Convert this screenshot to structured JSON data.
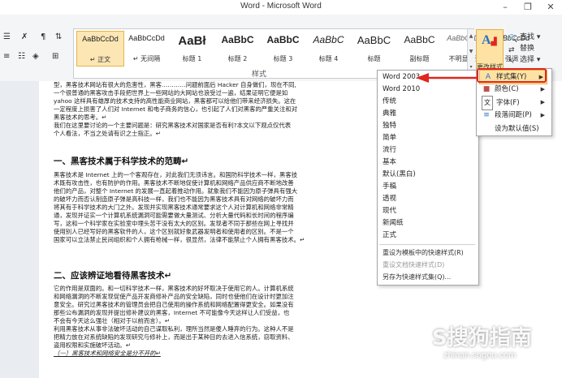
{
  "window": {
    "title": "Word - Microsoft Word",
    "min_symbol": "–",
    "restore_symbol": "❐",
    "close_symbol": "✕"
  },
  "ribbon": {
    "styles_group_label": "样式",
    "styles": [
      {
        "preview": "AaBbCcDd",
        "name": "↵ 正文",
        "selected": true
      },
      {
        "preview": "AaBbCcDd",
        "name": "↵ 无间隔",
        "selected": false
      },
      {
        "preview": "AaBł",
        "name": "标题 1",
        "selected": false
      },
      {
        "preview": "AaBbC",
        "name": "标题 2",
        "selected": false
      },
      {
        "preview": "AaBbC",
        "name": "标题 3",
        "selected": false
      },
      {
        "preview": "AaBbC",
        "name": "标题 4",
        "selected": false
      },
      {
        "preview": "AaBbC",
        "name": "标题",
        "selected": false
      },
      {
        "preview": "AaBbC",
        "name": "副标题",
        "selected": false
      },
      {
        "preview": "AaBbCcDd",
        "name": "不明显强调",
        "selected": false
      },
      {
        "preview": "AaBbCcDd",
        "name": "强调",
        "selected": false
      }
    ],
    "change_styles_label": "更改样式",
    "editing": {
      "find": "查找",
      "replace": "替换",
      "select": "选择"
    }
  },
  "change_styles_menu": {
    "items": [
      {
        "icon": "A",
        "label": "样式集(Y)",
        "has_arrow": true
      },
      {
        "icon": "■",
        "label": "颜色(C)",
        "has_arrow": true
      },
      {
        "icon": "文",
        "label": "字体(F)",
        "has_arrow": true
      },
      {
        "icon": "≡",
        "label": "段落间距(P)",
        "has_arrow": true
      },
      {
        "icon": "",
        "label": "设为默认值(S)",
        "has_arrow": false
      }
    ]
  },
  "style_set_menu": {
    "options": [
      "Word 2003",
      "Word 2010",
      "传统",
      "典雅",
      "独特",
      "简单",
      "流行",
      "基本",
      "默认(黑白)",
      "手稿",
      "透视",
      "现代",
      "新闻纸",
      "正式"
    ],
    "actions": [
      "重设为模板中的快速样式(R)",
      "重设文档快速样式(D)",
      "另存为快速样式集(Q)..."
    ]
  },
  "document": {
    "para_top": [
      "型，黑客技术网站有很大的危害性，黑客…………问题前面后 Hacker 自身做们，现在不同,",
      "一个很普通的黑客攻击手段把世界上一些网站的大网站也浪受过一遍，结果证明它便是如",
      "yahoo 这样具有雄厚的技术支持的高性能商业网站，黑客都可以给他们带来经济损失。这在",
      "一定程度上损害了人们对 Internet 和电子商务的信心，也引起了人们对黑客的严重关注和对",
      "黑客技术的思考。↵",
      "我们在这里要讨论的一个主要问题是：研究黑客技术对国家是否有利?本文以下观点仅代表",
      "个人看法，不当之处请有识之士指正。↵"
    ],
    "heading1": "一、黑客技术属于科学技术的范畴↵",
    "para_mid": [
      "黑客技术是 Internet 上的一个客观存在，对此我们无须讳言。和国防科学技术一样，黑客技",
      "术既有攻击性，也有防护的作用。黑客技术不断地促使计算机和网络产品供应商不断地改善",
      "他们的产品，对整个 Internet 的发展一直起着推动作用。就象我们不能因为原子弹具有强大",
      "的破坏力而否认制造原子弹是高科技一样，我们也不能因为黑客技术具有对网络的破坏力而",
      "将其有于科学技术的大门之外。发现并实现黑客技术通常要求这个人对计算机和网络非常精",
      "通，发现并证实一个计算机系统漏洞可能需要做大量测试、分析大量代码和长时间的程序编",
      "写，这和一个科学家在实验室中埋头苦干没有太大的区别。发现者不同于那些在网上寻找并",
      "使用别人已经写好的黑客软件的人，这个区别就好象武器发明者和使用者的区别。不是一个",
      "国家可以立法禁止民间组织和个人拥有枪械一样，很显然，法律不能禁止个人拥有黑客技术。↵"
    ],
    "heading2": "二、应该辨证地看待黑客技术↵",
    "para_bottom": [
      "它的作用是双面的。和一切科学技术一样，黑客技术的好坏取决于使用它的人。计算机系统",
      "和网络漏洞的不断发现促使产品开发商修补产品的安全缺陷，同时也使他们在设计时更加注",
      "意安全。研究过黑客技术的管理员会把自己使用的操作系统和网络配置得更安全。如果没有",
      "那些公布漏洞的发现并提出修补建议的黑客，Internet 不可能像今天这样让人们受益，也",
      "不会有今天这么强壮（相对于以前而言）。↵",
      "利用黑客技术从事非法破坏活动的自己谋取私利，理所当然是傻人睡弃的行为。这种人不是",
      "把精力放在对系统缺陷的发现研究与修补上，而是出于某种目的去进入信系统，窃取资料、",
      "盗用权限和实施破坏活动。↵",
      "（一）黑客技术和网络安全是分不开的↵"
    ]
  },
  "watermark": {
    "logo_text": "S搜狗指南",
    "url": "zhinan.sogou.com"
  },
  "colors": {
    "accent_red": "#e0261f",
    "highlight": "#fde2a3"
  }
}
